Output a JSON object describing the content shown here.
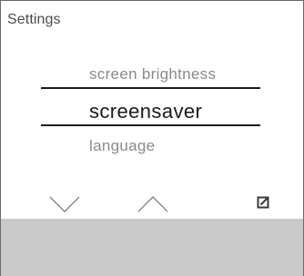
{
  "screen": {
    "title": "Settings",
    "menu": {
      "previous": "screen brightness",
      "selected": "screensaver",
      "next": "language"
    }
  },
  "controls": {
    "down_icon": "chevron-down-icon",
    "up_icon": "chevron-up-icon",
    "edit_icon": "edit-icon"
  },
  "colors": {
    "panel_gray": "#c9c9c9",
    "text_dark": "#1a1a1a",
    "text_muted": "#8a8a8a"
  }
}
